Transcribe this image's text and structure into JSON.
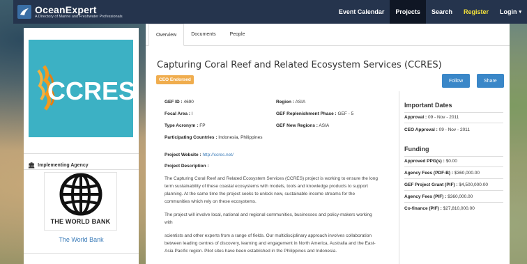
{
  "nav": {
    "logo_title": "OceanExpert",
    "logo_subtitle": "A Directory of Marine and Freshwater Professionals",
    "items": [
      "Event Calendar",
      "Projects",
      "Search",
      "Register",
      "Login"
    ]
  },
  "left": {
    "project_logo_text": "CCRES",
    "implementing_heading": "Implementing Agency",
    "agency_logo_text": "THE WORLD BANK",
    "agency_link": "The World Bank"
  },
  "tabs": [
    "Overview",
    "Documents",
    "People"
  ],
  "project": {
    "title": "Capturing Coral Reef and Related Ecosystem Services (CCRES)",
    "badge": "CEO Endorsed",
    "follow_label": "Follow",
    "share_label": "Share"
  },
  "details": {
    "gef_id_label": "GEF ID :",
    "gef_id": "4690",
    "region_label": "Region :",
    "region": "ASIA",
    "focal_area_label": "Focal Area :",
    "focal_area": "I",
    "replenishment_label": "GEF Replenishment Phase :",
    "replenishment": "GEF - 5",
    "type_acronym_label": "Type Acronym :",
    "type_acronym": "FP",
    "new_regions_label": "GEF New Regions :",
    "new_regions": "ASIA",
    "countries_label": "Participating Countries :",
    "countries": "Indonesia, Philippines",
    "website_label": "Project Website :",
    "website": "http://ccres.net/",
    "description_label": "Project Description :",
    "desc_p1": "The Capturing Coral Reef and Related Ecosystem Services (CCRES) project is working to ensure the long term sustainability of these coastal ecosystems with models, tools and knowledge products to support planning. At the same time the project seeks to unlock new, sustainable income streams for the communities which rely on these ecosystems.",
    "desc_p2": "The project will involve local, national and regional communities, businesses and policy-makers working with",
    "desc_p3": "scientists and other experts from a range of fields. Our multidisciplinary approach involves collaboration between leading centres of discovery, learning and engagement in North America, Australia and the East-Asia Pacific region. Pilot sites have been established in the Philippines and Indonesia."
  },
  "dates": {
    "heading": "Important Dates",
    "approval_label": "Approval :",
    "approval": "09 - Nov - 2011",
    "ceo_label": "CEO Approval :",
    "ceo": "09 - Nov - 2011"
  },
  "funding": {
    "heading": "Funding",
    "items": [
      {
        "label": "Approved PPG(s) :",
        "value": "$0.00"
      },
      {
        "label": "Agency Fees (PDF-B) :",
        "value": "$360,000.00"
      },
      {
        "label": "GEF Project Grant (PIF) :",
        "value": "$4,500,000.00"
      },
      {
        "label": "Agency Fees (PIF) :",
        "value": "$360,000.00"
      },
      {
        "label": "Co-finance (PIF) :",
        "value": "$27,810,000.00"
      }
    ]
  }
}
